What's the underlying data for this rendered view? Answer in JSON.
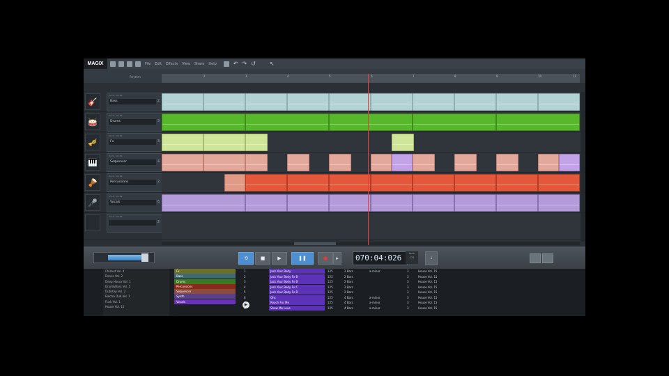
{
  "app": {
    "logo": "MAGIX",
    "menu": [
      "File",
      "Edit",
      "Effects",
      "View",
      "Share",
      "Help"
    ]
  },
  "timeline": {
    "overview_label": "Rhythm",
    "region_label": "Bar 1-20",
    "bars": [
      "2",
      "3",
      "4",
      "5",
      "6",
      "7",
      "8",
      "9",
      "10",
      "11"
    ]
  },
  "tracks": [
    {
      "name": "Bass",
      "icon": "bass-guitar-icon",
      "glyph": "🎸",
      "num": "2",
      "sub": "Vol 6 · Vol 69"
    },
    {
      "name": "Drums",
      "icon": "drum-kit-icon",
      "glyph": "🥁",
      "num": "3",
      "sub": "Vol 6 · Vol 69"
    },
    {
      "name": "Fx",
      "icon": "trumpet-icon",
      "glyph": "🎺",
      "num": "3",
      "sub": "Vol 6 · Vol 69"
    },
    {
      "name": "Sequencer",
      "icon": "keyboard-icon",
      "glyph": "🎹",
      "num": "4",
      "sub": "Vol 6 · Vol 69"
    },
    {
      "name": "Percussions",
      "icon": "bongos-icon",
      "glyph": "🪘",
      "num": "2",
      "sub": "Vol 6 · Vol 69"
    },
    {
      "name": "Vocals",
      "icon": "microphone-icon",
      "glyph": "🎤",
      "num": "6",
      "sub": "Vol 6 · Vol 69"
    },
    {
      "name": "",
      "icon": "empty-track-icon",
      "glyph": "",
      "num": "2",
      "sub": "Vol 6 · Vol 69"
    }
  ],
  "transport": {
    "time": "070:04:026",
    "tempo_label": "bpm",
    "tempo_value": "125"
  },
  "browser": {
    "categories": [
      "Chillout Vol. 4",
      "Dance Vol. 2",
      "Deep House Vol. 1",
      "Drum&Bass Vol. 1",
      "Dubstep Vol. 2",
      "Electro Dub Vol. 1",
      "Funk Vol. 1",
      "House Vol. 15"
    ],
    "instruments": [
      {
        "label": "Fx",
        "color": "#6a6f2a"
      },
      {
        "label": "Bass",
        "color": "#3f6a72"
      },
      {
        "label": "Drums",
        "color": "#3a7a22"
      },
      {
        "label": "Percussions",
        "color": "#8a2a1a"
      },
      {
        "label": "Sequencer",
        "color": "#8a4a3e"
      },
      {
        "label": "Synth",
        "color": "#5a3f8a"
      },
      {
        "label": "Vocals",
        "color": "#6a32b8"
      }
    ],
    "loops": [
      {
        "n": "1",
        "name": "Jack Your Body",
        "bpm": "125",
        "len": "2 Bars",
        "key": "a-minor",
        "v": "3",
        "album": "House Vol. 15"
      },
      {
        "n": "2",
        "name": "Jack Your Body Fx B",
        "bpm": "125",
        "len": "2 Bars",
        "key": "",
        "v": "3",
        "album": "House Vol. 15"
      },
      {
        "n": "3",
        "name": "Jack Your Body Fx B",
        "bpm": "125",
        "len": "2 Bars",
        "key": "",
        "v": "3",
        "album": "House Vol. 15"
      },
      {
        "n": "4",
        "name": "Jack Your Body Fx C",
        "bpm": "125",
        "len": "2 Bars",
        "key": "",
        "v": "3",
        "album": "House Vol. 15"
      },
      {
        "n": "5",
        "name": "Jack Your Body Fx D",
        "bpm": "125",
        "len": "2 Bars",
        "key": "",
        "v": "3",
        "album": "House Vol. 15"
      },
      {
        "n": "6",
        "name": "Ohs",
        "bpm": "125",
        "len": "4 Bars",
        "key": "a-minor",
        "v": "3",
        "album": "House Vol. 15"
      },
      {
        "n": "7",
        "name": "Reach For Me",
        "bpm": "125",
        "len": "4 Bars",
        "key": "a-minor",
        "v": "3",
        "album": "House Vol. 15"
      },
      {
        "n": "8",
        "name": "Show Me Love",
        "bpm": "125",
        "len": "4 Bars",
        "key": "a-minor",
        "v": "3",
        "album": "House Vol. 15"
      }
    ],
    "play_glyph": "▶"
  }
}
